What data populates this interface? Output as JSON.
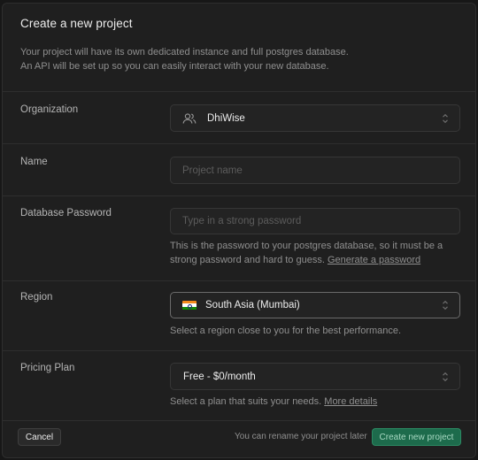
{
  "dialog": {
    "title": "Create a new project",
    "subtitle_line1": "Your project will have its own dedicated instance and full postgres database.",
    "subtitle_line2": "An API will be set up so you can easily interact with your new database."
  },
  "organization": {
    "label": "Organization",
    "value": "DhiWise",
    "icon": "users-icon"
  },
  "name": {
    "label": "Name",
    "value": "",
    "placeholder": "Project name"
  },
  "password": {
    "label": "Database Password",
    "value": "",
    "placeholder": "Type in a strong password",
    "help_text": "This is the password to your postgres database, so it must be a strong password and hard to guess.",
    "help_link": "Generate a password"
  },
  "region": {
    "label": "Region",
    "value": "South Asia (Mumbai)",
    "flag": "india-flag-icon",
    "help_text": "Select a region close to you for the best performance."
  },
  "pricing": {
    "label": "Pricing Plan",
    "value": "Free - $0/month",
    "help_text": "Select a plan that suits your needs.",
    "help_link": "More details"
  },
  "footer": {
    "cancel_label": "Cancel",
    "rename_note": "You can rename your project later",
    "create_label": "Create new project"
  },
  "colors": {
    "background": "#1f1f1f",
    "accent": "#1d6b4c"
  }
}
